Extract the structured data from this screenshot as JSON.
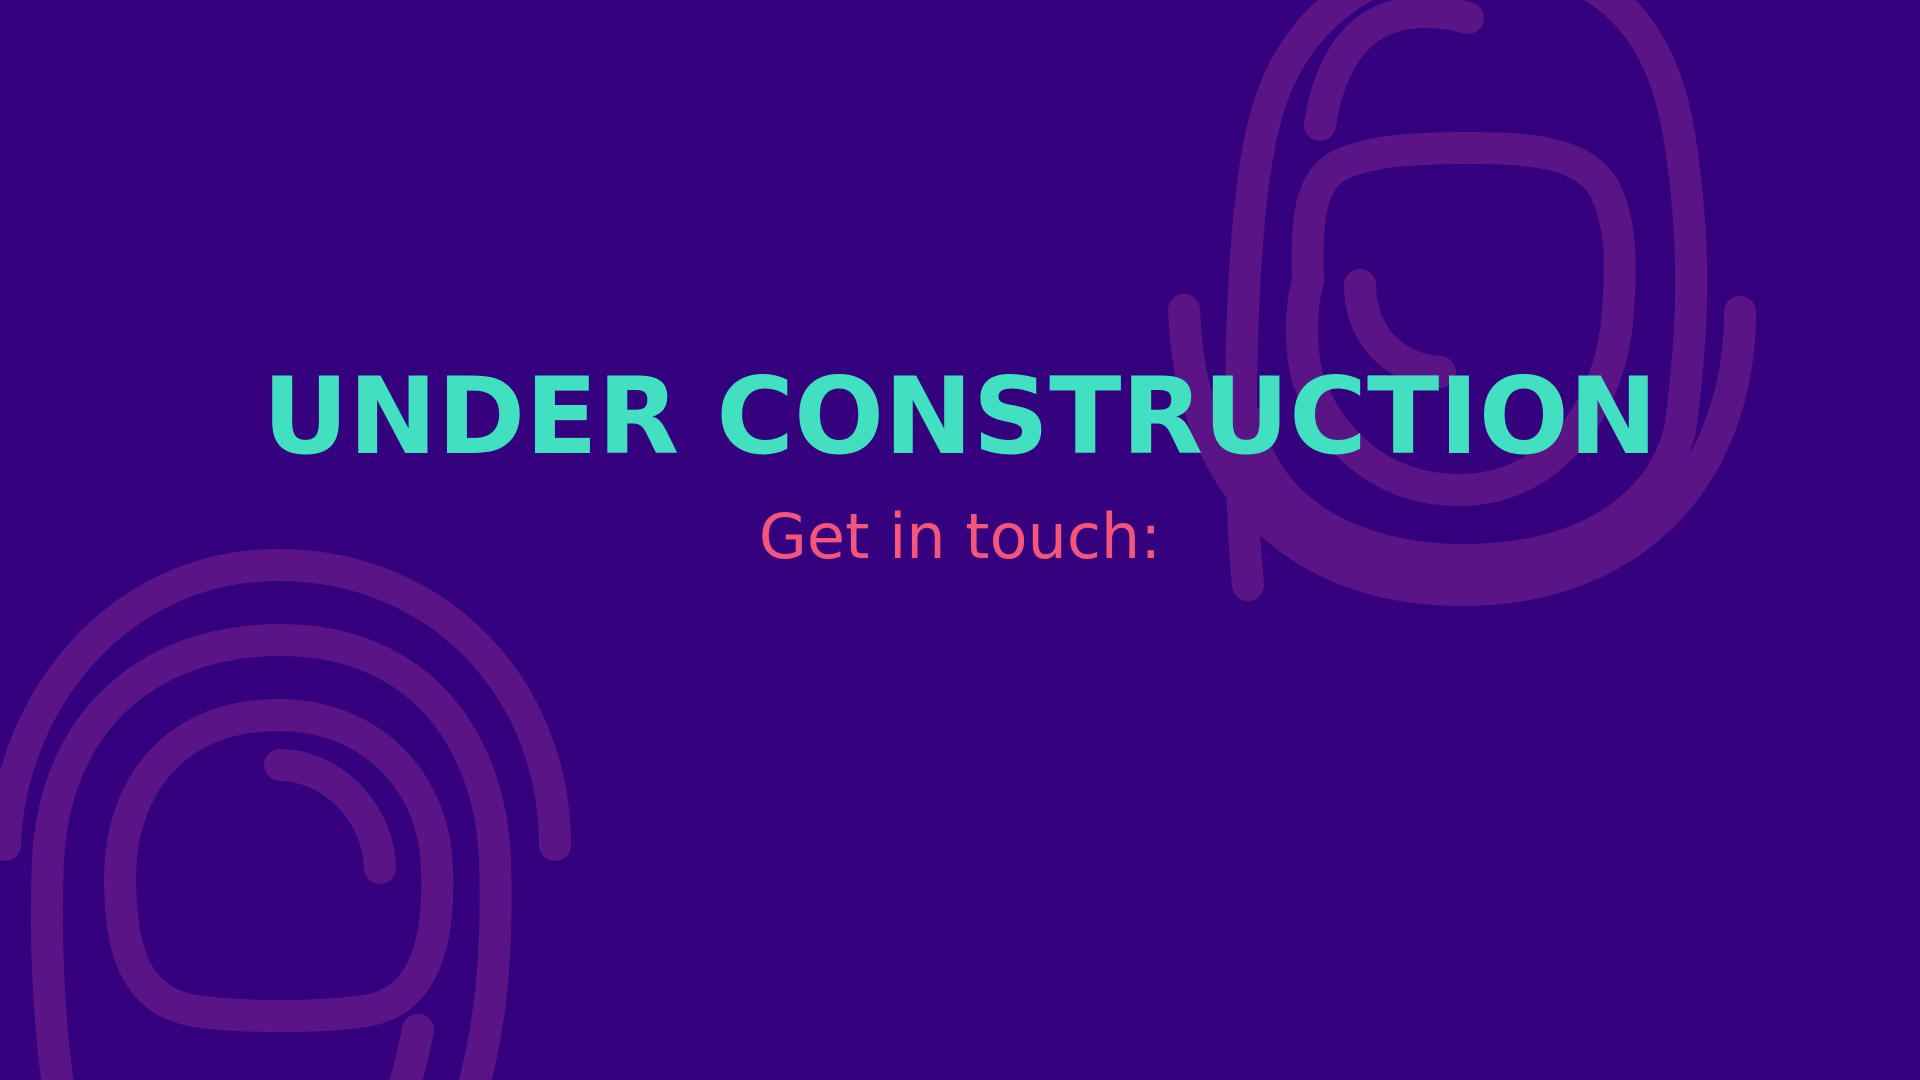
{
  "page": {
    "background_color": "#34007e",
    "decoration_color": "#5a1486",
    "headline": "UNDER CONSTRUCTION",
    "headline_color": "#40e0c0",
    "subline": "Get in touch:",
    "subline_color": "#f4557a"
  },
  "decorations": [
    {
      "name": "fingerprint-pattern-top-right",
      "icon": "fingerprint-icon"
    },
    {
      "name": "fingerprint-pattern-bottom-left",
      "icon": "fingerprint-icon"
    }
  ]
}
